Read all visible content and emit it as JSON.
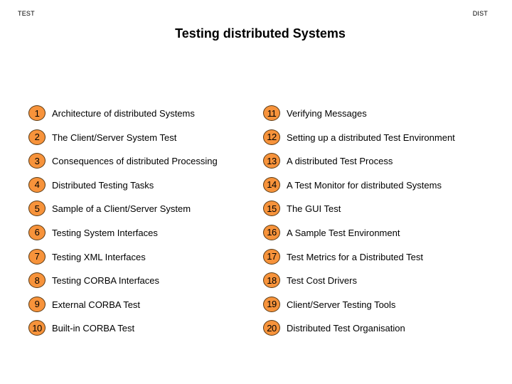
{
  "header": {
    "left_tag": "TEST",
    "right_tag": "DIST",
    "title": "Testing distributed Systems"
  },
  "colors": {
    "badge_fill": "#f7933b",
    "badge_border": "#5a3a14",
    "text": "#000000",
    "background": "#ffffff"
  },
  "toc": {
    "left": [
      {
        "number": "1",
        "label": "Architecture of distributed Systems"
      },
      {
        "number": "2",
        "label": "The Client/Server System Test"
      },
      {
        "number": "3",
        "label": "Consequences of distributed Processing"
      },
      {
        "number": "4",
        "label": "Distributed Testing Tasks"
      },
      {
        "number": "5",
        "label": "Sample of a Client/Server System"
      },
      {
        "number": "6",
        "label": "Testing System Interfaces"
      },
      {
        "number": "7",
        "label": "Testing XML Interfaces"
      },
      {
        "number": "8",
        "label": "Testing CORBA Interfaces"
      },
      {
        "number": "9",
        "label": "External CORBA Test"
      },
      {
        "number": "10",
        "label": "Built-in CORBA Test"
      }
    ],
    "right": [
      {
        "number": "11",
        "label": "Verifying Messages"
      },
      {
        "number": "12",
        "label": "Setting up a distributed Test Environment"
      },
      {
        "number": "13",
        "label": "A distributed Test Process"
      },
      {
        "number": "14",
        "label": "A Test Monitor for distributed Systems"
      },
      {
        "number": "15",
        "label": "The GUI Test"
      },
      {
        "number": "16",
        "label": "A Sample Test Environment"
      },
      {
        "number": "17",
        "label": "Test Metrics for a Distributed Test"
      },
      {
        "number": "18",
        "label": "Test Cost Drivers"
      },
      {
        "number": "19",
        "label": "Client/Server Testing Tools"
      },
      {
        "number": "20",
        "label": "Distributed Test Organisation"
      }
    ]
  }
}
